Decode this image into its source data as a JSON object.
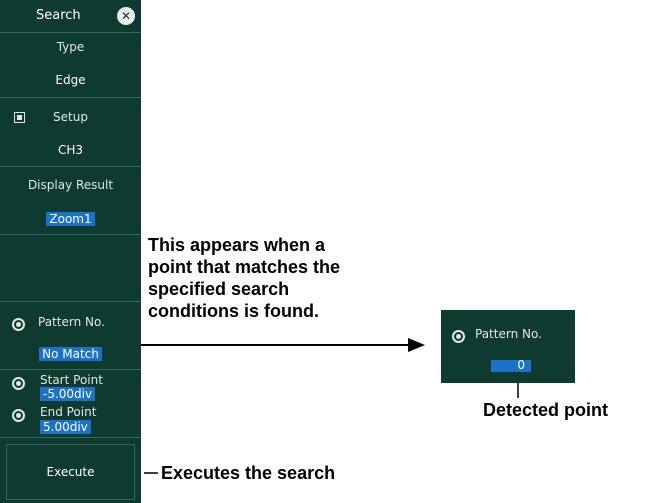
{
  "menu": {
    "title": "Search",
    "type_label": "Type",
    "type_value": "Edge",
    "setup_label": "Setup",
    "setup_value": "CH3",
    "display_result_label": "Display Result",
    "display_result_value": "Zoom1",
    "pattern_label": "Pattern No.",
    "pattern_value": "No Match",
    "start_point_label": "Start Point",
    "start_point_value": "-5.00div",
    "end_point_label": "End Point",
    "end_point_value": "5.00div",
    "execute_label": "Execute"
  },
  "popup": {
    "pattern_label": "Pattern No.",
    "pattern_value": "0"
  },
  "annotations": {
    "appears_line1": "This appears when a",
    "appears_line2": "point that matches the",
    "appears_line3": "specified search",
    "appears_line4": "conditions is found.",
    "detected": "Detected point",
    "executes": "Executes the search"
  },
  "colors": {
    "panel": "#0e3a2f",
    "separator": "#2f6a5a",
    "highlight": "#1b73c9",
    "text": "#ffffff"
  },
  "icons": [
    "close-icon",
    "setup-icon",
    "radio-icon"
  ]
}
